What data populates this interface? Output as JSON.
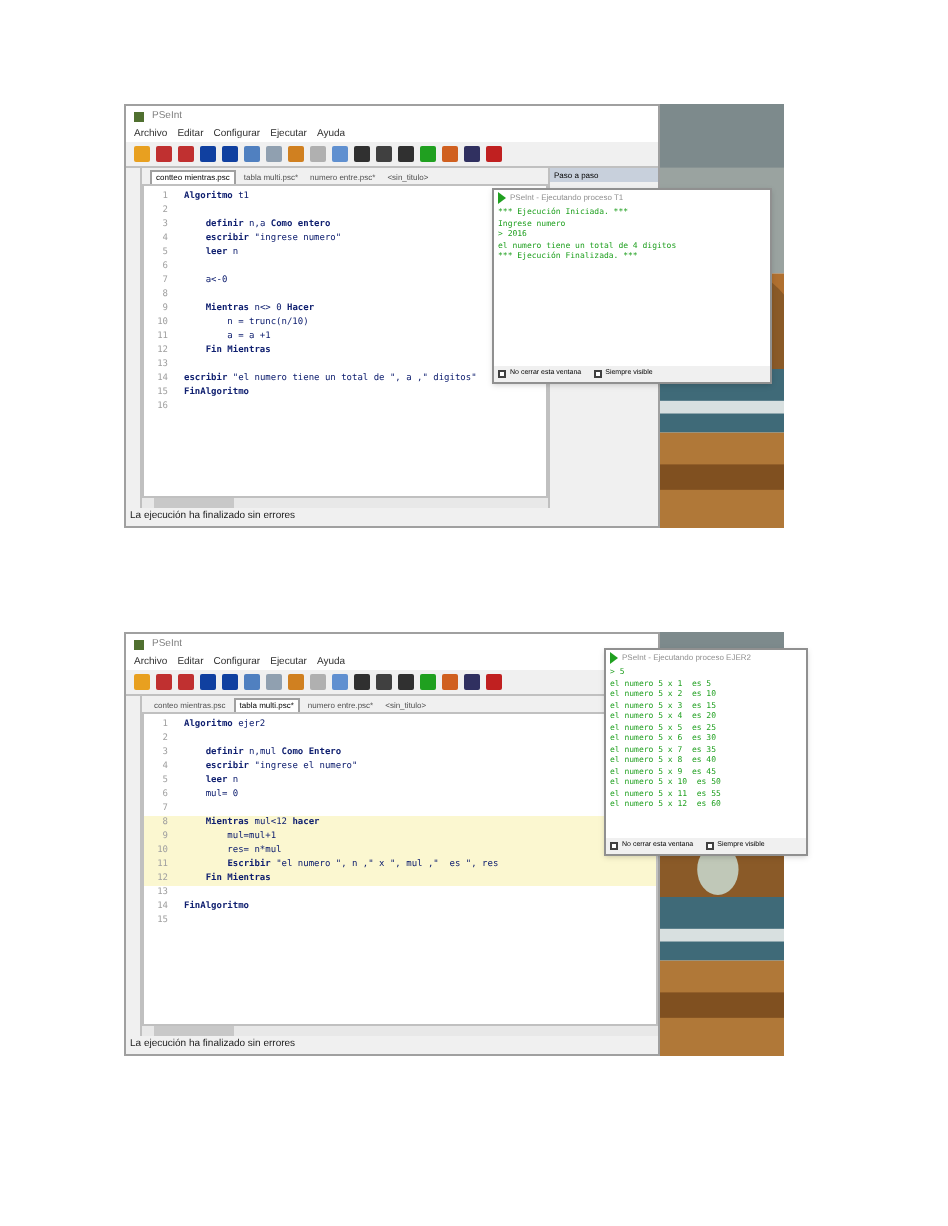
{
  "screenshots": [
    {
      "window_title": "PSeInt",
      "menu": [
        "Archivo",
        "Editar",
        "Configurar",
        "Ejecutar",
        "Ayuda"
      ],
      "tabs": [
        {
          "label": "contteo mientras.psc",
          "selected": true
        },
        {
          "label": "tabla multi.psc*",
          "selected": false
        },
        {
          "label": "numero entre.psc*",
          "selected": false
        },
        {
          "label": "<sin_titulo>",
          "selected": false
        }
      ],
      "code": [
        {
          "num": "1",
          "text": "**Algoritmo** t1",
          "highlighted": false
        },
        {
          "num": "2",
          "highlighted": false
        },
        {
          "num": "3",
          "text": "    **definir** n,a **Como entero**",
          "highlighted": false
        },
        {
          "num": "4",
          "text": "    **escribir** \"ingrese numero\"",
          "highlighted": false
        },
        {
          "num": "5",
          "text": "    **leer** n",
          "highlighted": false
        },
        {
          "num": "6",
          "highlighted": false
        },
        {
          "num": "7",
          "text": "    a<-0",
          "highlighted": false
        },
        {
          "num": "8",
          "highlighted": false
        },
        {
          "num": "9",
          "text": "    **Mientras** n<> 0 **Hacer**",
          "highlighted": false
        },
        {
          "num": "10",
          "text": "        n = trunc(n/10)",
          "highlighted": false
        },
        {
          "num": "11",
          "text": "        a = a +1",
          "highlighted": false
        },
        {
          "num": "12",
          "text": "    **Fin Mientras**",
          "highlighted": false
        },
        {
          "num": "13",
          "highlighted": false
        },
        {
          "num": "14",
          "text": "**escribir** \"el numero tiene un total de \", a ,\" digitos\"",
          "highlighted": false
        },
        {
          "num": "15",
          "text": "**FinAlgoritmo**",
          "highlighted": false
        },
        {
          "num": "16",
          "highlighted": false
        }
      ],
      "status": "La ejecución ha finalizado sin errores",
      "step_panel": "Paso a paso",
      "console": {
        "title": "PSeInt - Ejecutando proceso T1",
        "lines": [
          "*** Ejecución Iniciada. ***",
          "Ingrese numero",
          "> 2016",
          "el numero tiene un total de 4 digitos",
          "*** Ejecución Finalizada. ***"
        ],
        "options": [
          {
            "label": "No cerrar esta ventana",
            "checked": false
          },
          {
            "label": "Siempre visible",
            "checked": false
          }
        ]
      }
    },
    {
      "window_title": "PSeInt",
      "menu": [
        "Archivo",
        "Editar",
        "Configurar",
        "Ejecutar",
        "Ayuda"
      ],
      "tabs": [
        {
          "label": "conteo mientras.psc",
          "selected": false
        },
        {
          "label": "tabla multi.psc*",
          "selected": true
        },
        {
          "label": "numero entre.psc*",
          "selected": false
        },
        {
          "label": "<sin_titulo>",
          "selected": false
        }
      ],
      "code": [
        {
          "num": "1",
          "text": "**Algoritmo** ejer2",
          "highlighted": false
        },
        {
          "num": "2",
          "highlighted": false
        },
        {
          "num": "3",
          "text": "    **definir** n,mul **Como Entero**",
          "highlighted": false
        },
        {
          "num": "4",
          "text": "    **escribir** \"ingrese el numero\"",
          "highlighted": false
        },
        {
          "num": "5",
          "text": "    **leer** n",
          "highlighted": false
        },
        {
          "num": "6",
          "text": "    mul= 0",
          "highlighted": false
        },
        {
          "num": "7",
          "highlighted": false
        },
        {
          "num": "8",
          "text": "    **Mientras** mul<12 **hacer**",
          "highlighted": true
        },
        {
          "num": "9",
          "text": "        mul=mul+1",
          "highlighted": true
        },
        {
          "num": "10",
          "text": "        res= n*mul",
          "highlighted": true
        },
        {
          "num": "11",
          "text": "        **Escribir** \"el numero \", n ,\" x \", mul ,\"  es \", res",
          "highlighted": true
        },
        {
          "num": "12",
          "text": "    **Fin Mientras**",
          "highlighted": true
        },
        {
          "num": "13",
          "highlighted": false
        },
        {
          "num": "14",
          "text": "**FinAlgoritmo**",
          "highlighted": false
        },
        {
          "num": "15",
          "highlighted": false
        }
      ],
      "status": "La ejecución ha finalizado sin errores",
      "console": {
        "title": "PSeInt - Ejecutando proceso EJER2",
        "lines": [
          "> 5",
          "el numero 5 x 1  es 5",
          "el numero 5 x 2  es 10",
          "el numero 5 x 3  es 15",
          "el numero 5 x 4  es 20",
          "el numero 5 x 5  es 25",
          "el numero 5 x 6  es 30",
          "el numero 5 x 7  es 35",
          "el numero 5 x 8  es 40",
          "el numero 5 x 9  es 45",
          "el numero 5 x 10  es 50",
          "el numero 5 x 11  es 55",
          "el numero 5 x 12  es 60"
        ],
        "options": [
          {
            "label": "No cerrar esta ventana",
            "checked": false
          },
          {
            "label": "Siempre visible",
            "checked": false
          }
        ]
      }
    }
  ]
}
